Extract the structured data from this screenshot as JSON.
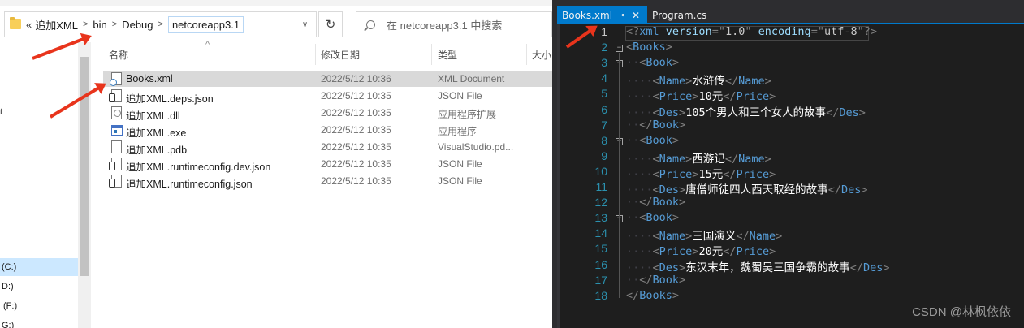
{
  "explorer": {
    "address": {
      "prefix": "«",
      "crumbs": [
        "追加XML",
        "bin",
        "Debug",
        "netcoreapp3.1"
      ],
      "dropdown_icon": "chevron-down-icon",
      "refresh_icon": "refresh-icon"
    },
    "search": {
      "placeholder": "在 netcoreapp3.1 中搜索"
    },
    "columns": [
      "名称",
      "修改日期",
      "类型",
      "大小"
    ],
    "files": [
      {
        "name": "Books.xml",
        "date": "2022/5/12 10:36",
        "type": "XML Document",
        "icon": "xml-file-icon",
        "selected": true
      },
      {
        "name": "追加XML.deps.json",
        "date": "2022/5/12 10:35",
        "type": "JSON File",
        "icon": "json-file-icon",
        "selected": false
      },
      {
        "name": "追加XML.dll",
        "date": "2022/5/12 10:35",
        "type": "应用程序扩展",
        "icon": "dll-file-icon",
        "selected": false
      },
      {
        "name": "追加XML.exe",
        "date": "2022/5/12 10:35",
        "type": "应用程序",
        "icon": "exe-file-icon",
        "selected": false
      },
      {
        "name": "追加XML.pdb",
        "date": "2022/5/12 10:35",
        "type": "VisualStudio.pd...",
        "icon": "pdb-file-icon",
        "selected": false
      },
      {
        "name": "追加XML.runtimeconfig.dev.json",
        "date": "2022/5/12 10:35",
        "type": "JSON File",
        "icon": "json-file-icon",
        "selected": false
      },
      {
        "name": "追加XML.runtimeconfig.json",
        "date": "2022/5/12 10:35",
        "type": "JSON File",
        "icon": "json-file-icon",
        "selected": false
      }
    ],
    "nav": {
      "drives": [
        "(C:)",
        "D:)",
        "(F:)",
        "G:)"
      ],
      "edge_text": "t"
    }
  },
  "editor": {
    "tabs": [
      {
        "label": "Books.xml",
        "active": true,
        "pin": "⊸",
        "close": "✕"
      },
      {
        "label": "Program.cs",
        "active": false
      }
    ],
    "current_line": 1,
    "lines": [
      {
        "n": "1",
        "fold": "",
        "html": "<span class='t-br'>&lt;?</span><span class='t-tag'>xml</span> <span class='t-attr'>version</span><span class='t-br'>=</span><span class='t-br'>\"</span><span class='t-val'>1.0</span><span class='t-br'>\"</span> <span class='t-attr'>encoding</span><span class='t-br'>=</span><span class='t-br'>\"</span><span class='t-val'>utf-8</span><span class='t-br'>\"</span><span class='t-br'>?&gt;</span>"
      },
      {
        "n": "2",
        "fold": "−",
        "html": "<span class='t-br'>&lt;</span><span class='t-tag'>Books</span><span class='t-br'>&gt;</span>"
      },
      {
        "n": "3",
        "fold": "−",
        "html": "<span class='ws'>··</span><span class='t-br'>&lt;</span><span class='t-tag'>Book</span><span class='t-br'>&gt;</span>"
      },
      {
        "n": "4",
        "fold": "",
        "html": "<span class='ws'>····</span><span class='t-br'>&lt;</span><span class='t-tag'>Name</span><span class='t-br'>&gt;</span><span class='t-txt'>水浒传</span><span class='t-br'>&lt;/</span><span class='t-tag'>Name</span><span class='t-br'>&gt;</span>"
      },
      {
        "n": "5",
        "fold": "",
        "html": "<span class='ws'>····</span><span class='t-br'>&lt;</span><span class='t-tag'>Price</span><span class='t-br'>&gt;</span><span class='t-txt'>10元</span><span class='t-br'>&lt;/</span><span class='t-tag'>Price</span><span class='t-br'>&gt;</span>"
      },
      {
        "n": "6",
        "fold": "",
        "html": "<span class='ws'>····</span><span class='t-br'>&lt;</span><span class='t-tag'>Des</span><span class='t-br'>&gt;</span><span class='t-txt'>105个男人和三个女人的故事</span><span class='t-br'>&lt;/</span><span class='t-tag'>Des</span><span class='t-br'>&gt;</span>"
      },
      {
        "n": "7",
        "fold": "",
        "html": "<span class='ws'>··</span><span class='t-br'>&lt;/</span><span class='t-tag'>Book</span><span class='t-br'>&gt;</span>"
      },
      {
        "n": "8",
        "fold": "−",
        "html": "<span class='ws'>··</span><span class='t-br'>&lt;</span><span class='t-tag'>Book</span><span class='t-br'>&gt;</span>"
      },
      {
        "n": "9",
        "fold": "",
        "html": "<span class='ws'>····</span><span class='t-br'>&lt;</span><span class='t-tag'>Name</span><span class='t-br'>&gt;</span><span class='t-txt'>西游记</span><span class='t-br'>&lt;/</span><span class='t-tag'>Name</span><span class='t-br'>&gt;</span>"
      },
      {
        "n": "10",
        "fold": "",
        "html": "<span class='ws'>····</span><span class='t-br'>&lt;</span><span class='t-tag'>Price</span><span class='t-br'>&gt;</span><span class='t-txt'>15元</span><span class='t-br'>&lt;/</span><span class='t-tag'>Price</span><span class='t-br'>&gt;</span>"
      },
      {
        "n": "11",
        "fold": "",
        "html": "<span class='ws'>····</span><span class='t-br'>&lt;</span><span class='t-tag'>Des</span><span class='t-br'>&gt;</span><span class='t-txt'>唐僧师徒四人西天取经的故事</span><span class='t-br'>&lt;/</span><span class='t-tag'>Des</span><span class='t-br'>&gt;</span>"
      },
      {
        "n": "12",
        "fold": "",
        "html": "<span class='ws'>··</span><span class='t-br'>&lt;/</span><span class='t-tag'>Book</span><span class='t-br'>&gt;</span>"
      },
      {
        "n": "13",
        "fold": "−",
        "html": "<span class='ws'>··</span><span class='t-br'>&lt;</span><span class='t-tag'>Book</span><span class='t-br'>&gt;</span>"
      },
      {
        "n": "14",
        "fold": "",
        "html": "<span class='ws'>····</span><span class='t-br'>&lt;</span><span class='t-tag'>Name</span><span class='t-br'>&gt;</span><span class='t-txt'>三国演义</span><span class='t-br'>&lt;/</span><span class='t-tag'>Name</span><span class='t-br'>&gt;</span>"
      },
      {
        "n": "15",
        "fold": "",
        "html": "<span class='ws'>····</span><span class='t-br'>&lt;</span><span class='t-tag'>Price</span><span class='t-br'>&gt;</span><span class='t-txt'>20元</span><span class='t-br'>&lt;/</span><span class='t-tag'>Price</span><span class='t-br'>&gt;</span>"
      },
      {
        "n": "16",
        "fold": "",
        "html": "<span class='ws'>····</span><span class='t-br'>&lt;</span><span class='t-tag'>Des</span><span class='t-br'>&gt;</span><span class='t-txt'>东汉末年，魏蜀吴三国争霸的故事</span><span class='t-br'>&lt;/</span><span class='t-tag'>Des</span><span class='t-br'>&gt;</span>"
      },
      {
        "n": "17",
        "fold": "",
        "html": "<span class='ws'>··</span><span class='t-br'>&lt;/</span><span class='t-tag'>Book</span><span class='t-br'>&gt;</span>"
      },
      {
        "n": "18",
        "fold": "",
        "html": "<span class='t-br'>&lt;/</span><span class='t-tag'>Books</span><span class='t-br'>&gt;</span>"
      }
    ]
  },
  "watermark": "CSDN @林枫依依",
  "colors": {
    "vs_accent": "#007acc",
    "xml_tag": "#569cd6",
    "xml_attr": "#9cdcfe",
    "line_number": "#2b91af",
    "annotation_arrow": "#e8341c",
    "selection": "#d9d9d9"
  }
}
